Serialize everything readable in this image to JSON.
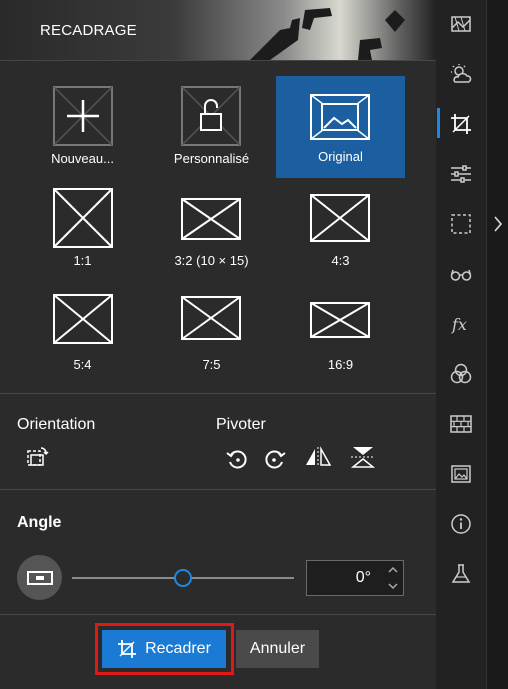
{
  "header": {
    "title": "RECADRAGE"
  },
  "ratios": [
    {
      "label": "Nouveau...",
      "icon": "add-icon"
    },
    {
      "label": "Personnalisé",
      "icon": "unlock-icon"
    },
    {
      "label": "Original",
      "icon": "image-icon",
      "selected": true
    },
    {
      "label": "1:1",
      "icon": "ratio-1-1-icon"
    },
    {
      "label": "3:2 (10 × 15)",
      "icon": "ratio-3-2-icon"
    },
    {
      "label": "4:3",
      "icon": "ratio-4-3-icon"
    },
    {
      "label": "5:4",
      "icon": "ratio-5-4-icon"
    },
    {
      "label": "7:5",
      "icon": "ratio-7-5-icon"
    },
    {
      "label": "16:9",
      "icon": "ratio-16-9-icon"
    }
  ],
  "orientation": {
    "label": "Orientation"
  },
  "rotate": {
    "label": "Pivoter"
  },
  "angle": {
    "title": "Angle",
    "value": "0°",
    "slider_fraction": 0.5
  },
  "actions": {
    "crop_label": "Recadrer",
    "cancel_label": "Annuler"
  },
  "colors": {
    "accent": "#1a7ad4",
    "selected": "#1b5fa0",
    "highlight": "#e01818"
  },
  "toolbar": [
    "frames-icon",
    "weather-icon",
    "crop-icon",
    "adjust-icon",
    "selection-icon",
    "glasses-icon",
    "fx-icon",
    "color-circles-icon",
    "texture-icon",
    "image-icon",
    "info-icon",
    "flask-icon"
  ]
}
